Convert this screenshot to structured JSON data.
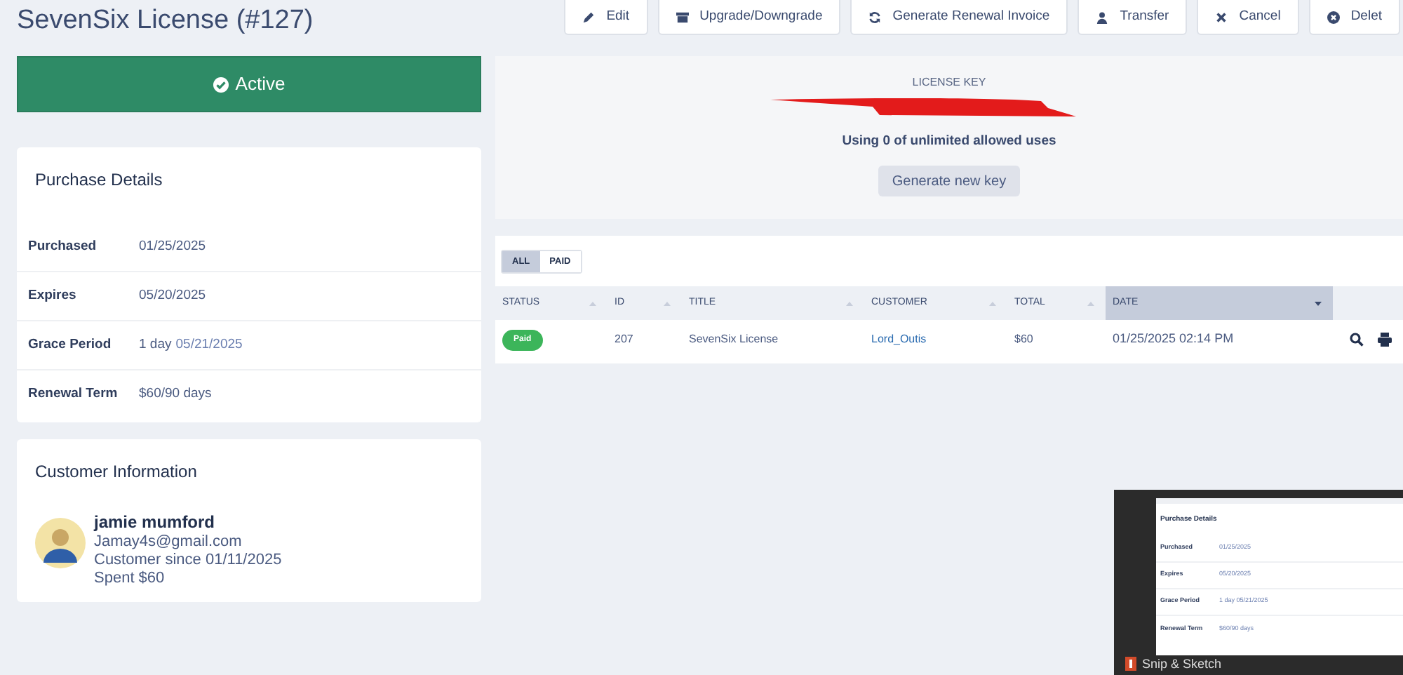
{
  "page_title": "SevenSix License (#127)",
  "actions": [
    {
      "kind": "edit",
      "label": "Edit"
    },
    {
      "kind": "upgrade",
      "label": "Upgrade/Downgrade"
    },
    {
      "kind": "renew",
      "label": "Generate Renewal Invoice"
    },
    {
      "kind": "transfer",
      "label": "Transfer"
    },
    {
      "kind": "cancel",
      "label": "Cancel"
    },
    {
      "kind": "delete",
      "label": "Delet"
    }
  ],
  "status_banner": {
    "label": "Active"
  },
  "purchase_details": {
    "title": "Purchase Details",
    "rows": [
      {
        "label": "Purchased",
        "value": "01/25/2025"
      },
      {
        "label": "Expires",
        "value": "05/20/2025"
      },
      {
        "label": "Grace Period",
        "value": "1 day",
        "date": "05/21/2025"
      },
      {
        "label": "Renewal Term",
        "value": "$60/90 days"
      }
    ]
  },
  "customer_information": {
    "title": "Customer Information",
    "name": "jamie mumford",
    "email": "Jamay4s@gmail.com",
    "since": "Customer since 01/11/2025",
    "spent": "Spent $60"
  },
  "license_key": {
    "heading": "LICENSE KEY",
    "usage": "Using 0 of unlimited allowed uses",
    "button": "Generate new key"
  },
  "filters": [
    {
      "label": "ALL",
      "selected": true
    },
    {
      "label": "PAID",
      "selected": false
    }
  ],
  "table": {
    "columns": [
      {
        "label": "STATUS",
        "sorted": false
      },
      {
        "label": "ID",
        "sorted": false
      },
      {
        "label": "TITLE",
        "sorted": false
      },
      {
        "label": "CUSTOMER",
        "sorted": false
      },
      {
        "label": "TOTAL",
        "sorted": false
      },
      {
        "label": "DATE",
        "sorted": true
      }
    ],
    "rows": [
      {
        "status": "Paid",
        "id": "207",
        "title": "SevenSix License",
        "customer": "Lord_Outis",
        "total": "$60",
        "date": "01/25/2025 02:14 PM"
      }
    ]
  },
  "notification": {
    "app": "Snip & Sketch",
    "preview": {
      "title": "Purchase Details",
      "rows": [
        {
          "label": "Purchased",
          "value": "01/25/2025"
        },
        {
          "label": "Expires",
          "value": "05/20/2025"
        },
        {
          "label": "Grace Period",
          "value": "1 day 05/21/2025"
        },
        {
          "label": "Renewal Term",
          "value": "$60/90 days"
        }
      ]
    }
  }
}
